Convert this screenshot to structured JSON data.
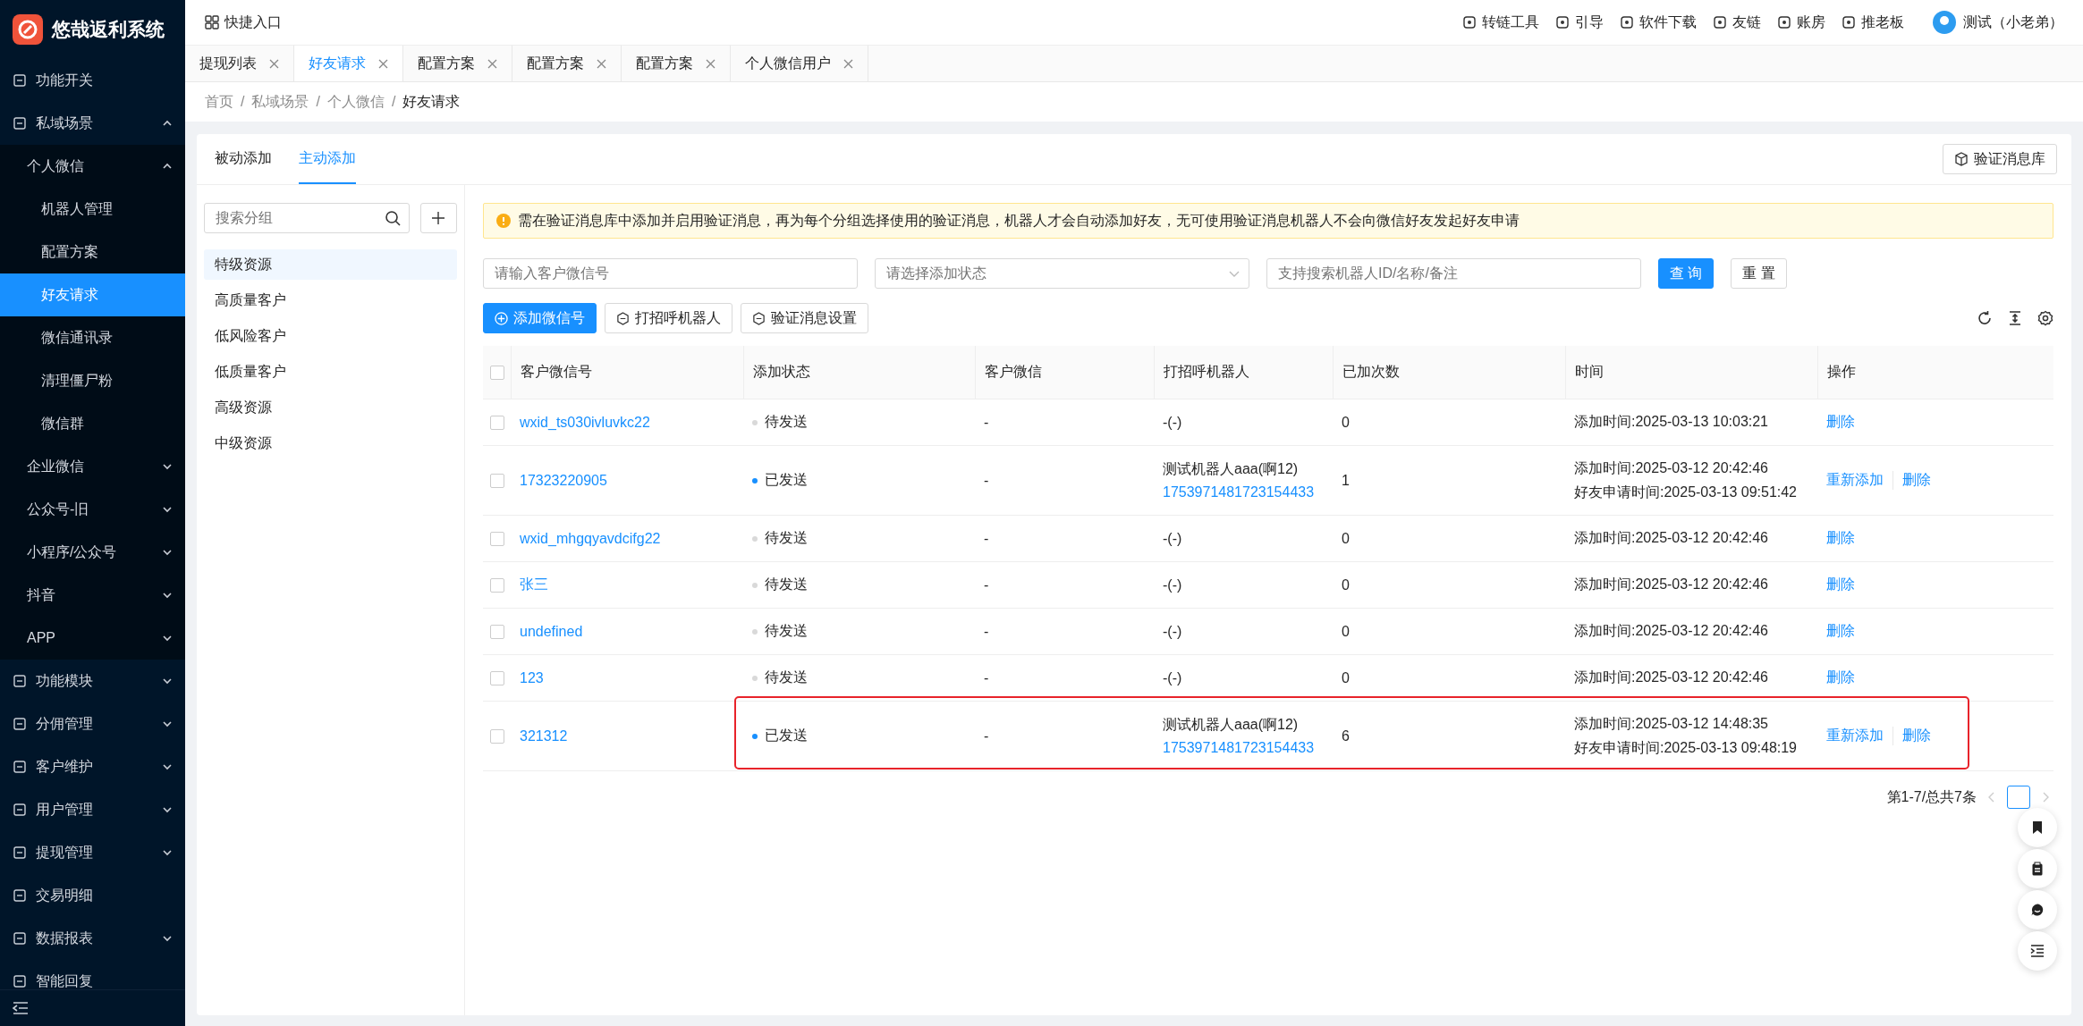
{
  "app": {
    "title": "悠哉返利系统"
  },
  "sidebar": {
    "items": [
      {
        "label": "功能开关",
        "selected": false
      },
      {
        "label": "私域场景",
        "selected": false,
        "expanded": true,
        "children": [
          {
            "label": "个人微信",
            "selected": false,
            "expanded": true,
            "children": [
              {
                "label": "机器人管理",
                "selected": false
              },
              {
                "label": "配置方案",
                "selected": false
              },
              {
                "label": "好友请求",
                "selected": true
              },
              {
                "label": "微信通讯录",
                "selected": false
              },
              {
                "label": "清理僵尸粉",
                "selected": false
              },
              {
                "label": "微信群",
                "selected": false
              }
            ]
          },
          {
            "label": "企业微信",
            "selected": false,
            "expanded": false
          },
          {
            "label": "公众号-旧",
            "selected": false,
            "expanded": false
          },
          {
            "label": "小程序/公众号",
            "selected": false,
            "expanded": false
          },
          {
            "label": "抖音",
            "selected": false,
            "expanded": false
          },
          {
            "label": "APP",
            "selected": false,
            "expanded": false
          }
        ]
      },
      {
        "label": "功能模块",
        "selected": false,
        "expanded": false
      },
      {
        "label": "分佣管理",
        "selected": false,
        "expanded": false
      },
      {
        "label": "客户维护",
        "selected": false,
        "expanded": false
      },
      {
        "label": "用户管理",
        "selected": false,
        "expanded": false
      },
      {
        "label": "提现管理",
        "selected": false,
        "expanded": false
      },
      {
        "label": "交易明细",
        "selected": false
      },
      {
        "label": "数据报表",
        "selected": false,
        "expanded": false
      },
      {
        "label": "智能回复",
        "selected": false
      }
    ]
  },
  "header": {
    "shortcut": "快捷入口",
    "links": [
      "转链工具",
      "引导",
      "软件下载",
      "友链",
      "账房",
      "推老板"
    ],
    "user": "测试（小老弟）"
  },
  "tabs": [
    {
      "label": "提现列表",
      "selected": false
    },
    {
      "label": "好友请求",
      "selected": true
    },
    {
      "label": "配置方案",
      "selected": false
    },
    {
      "label": "配置方案",
      "selected": false
    },
    {
      "label": "配置方案",
      "selected": false
    },
    {
      "label": "个人微信用户",
      "selected": false
    }
  ],
  "breadcrumb": {
    "separator": "/",
    "items": [
      "首页",
      "私域场景",
      "个人微信",
      "好友请求"
    ]
  },
  "card": {
    "tabs": [
      {
        "label": "被动添加",
        "selected": false
      },
      {
        "label": "主动添加",
        "selected": true
      }
    ],
    "library_button": "验证消息库"
  },
  "groups": {
    "search_placeholder": "搜索分组",
    "items": [
      {
        "label": "特级资源",
        "selected": true
      },
      {
        "label": "高质量客户",
        "selected": false
      },
      {
        "label": "低风险客户",
        "selected": false
      },
      {
        "label": "低质量客户",
        "selected": false
      },
      {
        "label": "高级资源",
        "selected": false
      },
      {
        "label": "中级资源",
        "selected": false
      }
    ]
  },
  "alert": "需在验证消息库中添加并启用验证消息，再为每个分组选择使用的验证消息，机器人才会自动添加好友，无可使用验证消息机器人不会向微信好友发起好友申请",
  "filters": [
    {
      "kind": "input",
      "placeholder": "请输入客户微信号"
    },
    {
      "kind": "select",
      "placeholder": "请选择添加状态"
    },
    {
      "kind": "input",
      "placeholder": "支持搜索机器人ID/名称/备注"
    }
  ],
  "filter_buttons": [
    {
      "kind": "primary",
      "label": "查 询"
    },
    {
      "kind": "default",
      "label": "重 置"
    }
  ],
  "actions": [
    {
      "kind": "primary",
      "label": "添加微信号"
    },
    {
      "kind": "default",
      "label": "打招呼机器人"
    },
    {
      "kind": "default",
      "label": "验证消息设置"
    }
  ],
  "table": {
    "all_checked": false,
    "columns": [
      "客户微信号",
      "添加状态",
      "客户微信",
      "打招呼机器人",
      "已加次数",
      "时间",
      "操作"
    ],
    "rows": [
      {
        "checked": false,
        "highlighted": false,
        "account": "wxid_ts030ivluvkc22",
        "status": "待发送",
        "sent": false,
        "wechat": "-",
        "robot": "-(-)",
        "count": "0",
        "times": [
          "添加时间:2025-03-13 10:03:21"
        ],
        "actions": [
          "删除"
        ]
      },
      {
        "checked": false,
        "highlighted": false,
        "account": "17323220905",
        "status": "已发送",
        "sent": true,
        "wechat": "-",
        "robot": "测试机器人aaa(啊12)",
        "robot_id": "1753971481723154433",
        "count": "1",
        "times": [
          "添加时间:2025-03-12 20:42:46",
          "好友申请时间:2025-03-13 09:51:42"
        ],
        "actions": [
          "重新添加",
          "删除"
        ]
      },
      {
        "checked": false,
        "highlighted": false,
        "account": "wxid_mhgqyavdcifg22",
        "status": "待发送",
        "sent": false,
        "wechat": "-",
        "robot": "-(-)",
        "count": "0",
        "times": [
          "添加时间:2025-03-12 20:42:46"
        ],
        "actions": [
          "删除"
        ]
      },
      {
        "checked": false,
        "highlighted": false,
        "account": "张三",
        "status": "待发送",
        "sent": false,
        "wechat": "-",
        "robot": "-(-)",
        "count": "0",
        "times": [
          "添加时间:2025-03-12 20:42:46"
        ],
        "actions": [
          "删除"
        ]
      },
      {
        "checked": false,
        "highlighted": false,
        "account": "undefined",
        "status": "待发送",
        "sent": false,
        "wechat": "-",
        "robot": "-(-)",
        "count": "0",
        "times": [
          "添加时间:2025-03-12 20:42:46"
        ],
        "actions": [
          "删除"
        ]
      },
      {
        "checked": false,
        "highlighted": false,
        "account": "123",
        "status": "待发送",
        "sent": false,
        "wechat": "-",
        "robot": "-(-)",
        "count": "0",
        "times": [
          "添加时间:2025-03-12 20:42:46"
        ],
        "actions": [
          "删除"
        ]
      },
      {
        "checked": false,
        "highlighted": true,
        "account": "321312",
        "status": "已发送",
        "sent": true,
        "wechat": "-",
        "robot": "测试机器人aaa(啊12)",
        "robot_id": "1753971481723154433",
        "count": "6",
        "times": [
          "添加时间:2025-03-12 14:48:35",
          "好友申请时间:2025-03-13 09:48:19"
        ],
        "actions": [
          "重新添加",
          "删除"
        ]
      }
    ]
  },
  "pagination": {
    "summary": "第1-7/总共7条"
  }
}
